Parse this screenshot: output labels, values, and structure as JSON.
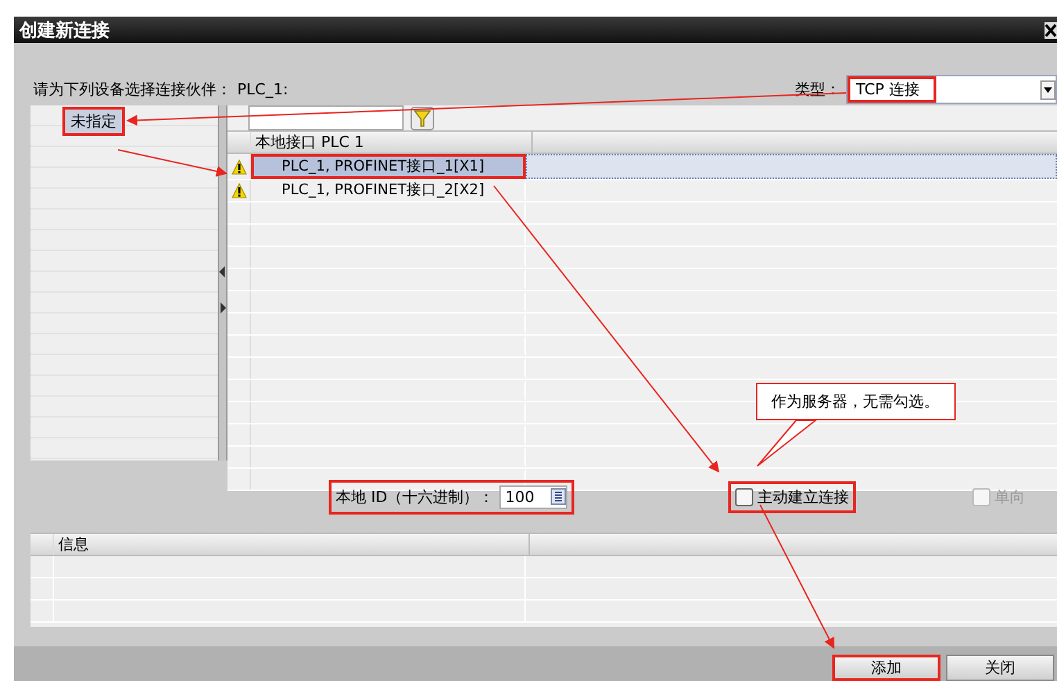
{
  "window": {
    "title": "创建新连接"
  },
  "prompt": {
    "label": "请为下列设备选择连接伙伴：",
    "device": "PLC_1:"
  },
  "type": {
    "label": "类型：",
    "value": "TCP 连接",
    "highlighted": true
  },
  "partners": [
    {
      "label": "未指定",
      "selected": true,
      "highlighted": true
    }
  ],
  "interfaces": {
    "column": "本地接口 PLC 1",
    "rows": [
      {
        "label": "PLC_1, PROFINET接口_1[X1]",
        "warning": true,
        "selected": true,
        "highlighted": true
      },
      {
        "label": "PLC_1, PROFINET接口_2[X2]",
        "warning": true,
        "selected": false,
        "highlighted": false
      }
    ]
  },
  "local_id": {
    "label": "本地 ID（十六进制）：",
    "value": "100",
    "highlighted": true
  },
  "options": [
    {
      "label": "主动建立连接",
      "checked": false,
      "disabled": false,
      "highlighted": true
    },
    {
      "label": "单向",
      "checked": false,
      "disabled": true,
      "highlighted": false
    }
  ],
  "info": {
    "column": "信息"
  },
  "buttons": [
    {
      "label": "添加",
      "highlighted": true
    },
    {
      "label": "关闭",
      "highlighted": false
    }
  ],
  "callout": {
    "text": "作为服务器，无需勾选。"
  }
}
